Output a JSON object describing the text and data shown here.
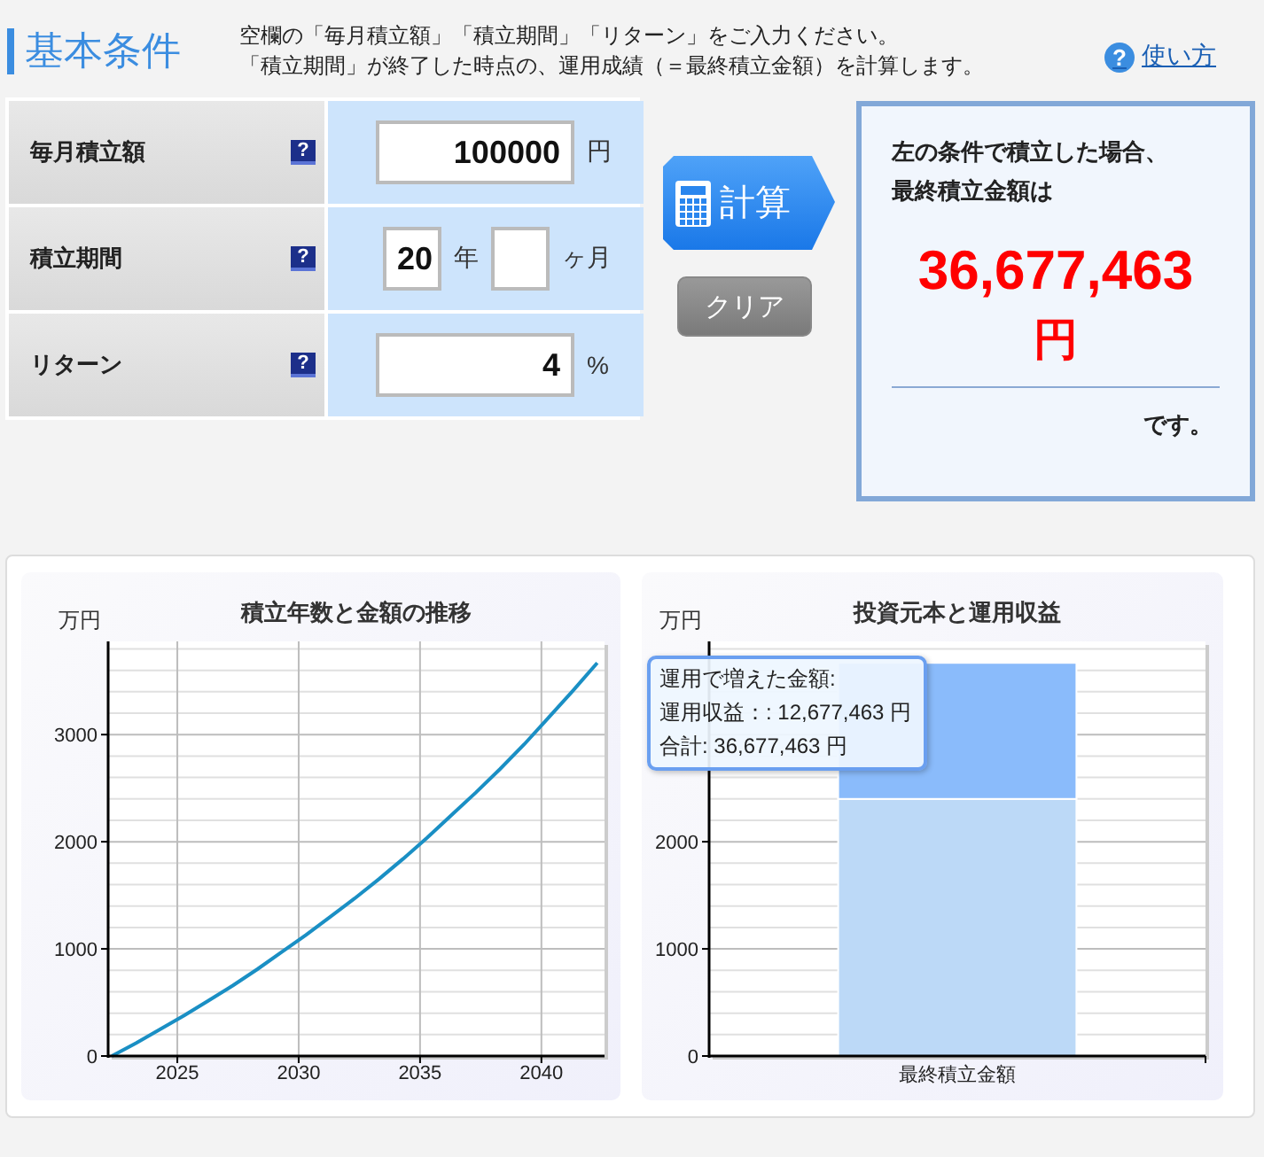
{
  "header": {
    "title": "基本条件",
    "description": [
      "空欄の「毎月積立額」「積立期間」「リターン」をご入力ください。",
      "「積立期間」が終了した時点の、運用成績（＝最終積立金額）を計算します。"
    ],
    "help": {
      "icon": "?",
      "label": "使い方"
    }
  },
  "form": {
    "rows": [
      {
        "label": "毎月積立額",
        "help": "?",
        "inputs": [
          {
            "kind": "wide",
            "value": "100000",
            "unit": "円"
          }
        ]
      },
      {
        "label": "積立期間",
        "help": "?",
        "inputs": [
          {
            "kind": "narrow",
            "value": "20",
            "unit": "年"
          },
          {
            "kind": "narrow",
            "unit": "ヶ月"
          }
        ]
      },
      {
        "label": "リターン",
        "help": "?",
        "inputs": [
          {
            "kind": "wide",
            "value": "4",
            "unit": "%"
          }
        ]
      }
    ]
  },
  "buttons": [
    {
      "kind": "calculate",
      "label": "計算"
    },
    {
      "kind": "clear",
      "label": "クリア"
    }
  ],
  "result": {
    "intro": [
      "左の条件で積立した場合、",
      "最終積立金額は"
    ],
    "amount": "36,677,463",
    "unit": "円",
    "suffix": "です。"
  },
  "charts": [
    {
      "chart_data": {
        "type": "line",
        "title": "積立年数と金額の推移",
        "ylabel": "万円",
        "x": [
          2022.3,
          2023.3,
          2024.3,
          2025.3,
          2026.3,
          2027.3,
          2028.3,
          2029.3,
          2030.3,
          2031.3,
          2032.3,
          2033.3,
          2034.3,
          2035.3,
          2036.3,
          2037.3,
          2038.3,
          2039.3,
          2040.3,
          2041.3,
          2042.3
        ],
        "series": [
          {
            "color": "#1a8fc4",
            "values": [
              0,
              120,
              250,
              380,
              520,
              660,
              810,
              970,
              1130,
              1300,
              1470,
              1650,
              1840,
              2040,
              2250,
              2460,
              2680,
              2910,
              3160,
              3410,
              3670
            ]
          }
        ],
        "xlim": [
          2022.15,
          2042.6
        ],
        "ylim": [
          0,
          3870
        ],
        "xticks": [
          2025,
          2030,
          2035,
          2040
        ],
        "yticks": [
          0,
          1000,
          2000,
          3000
        ],
        "grid": true
      }
    },
    {
      "chart_data": {
        "type": "bar",
        "title": "投資元本と運用収益",
        "ylabel": "万円",
        "categories": [
          "最終積立金額"
        ],
        "stacked": true,
        "series": [
          {
            "color": "#bcd9f7",
            "values": [
              2400
            ]
          },
          {
            "color": "#8abbfb",
            "values": [
              1270
            ]
          }
        ],
        "ylim": [
          0,
          3870
        ],
        "yticks": [
          0,
          1000,
          2000
        ],
        "grid": true
      },
      "tooltip": {
        "title": "運用で増えた金額:",
        "lines": [
          "運用収益：: 12,677,463 円",
          "合計:  36,677,463 円"
        ]
      }
    }
  ]
}
